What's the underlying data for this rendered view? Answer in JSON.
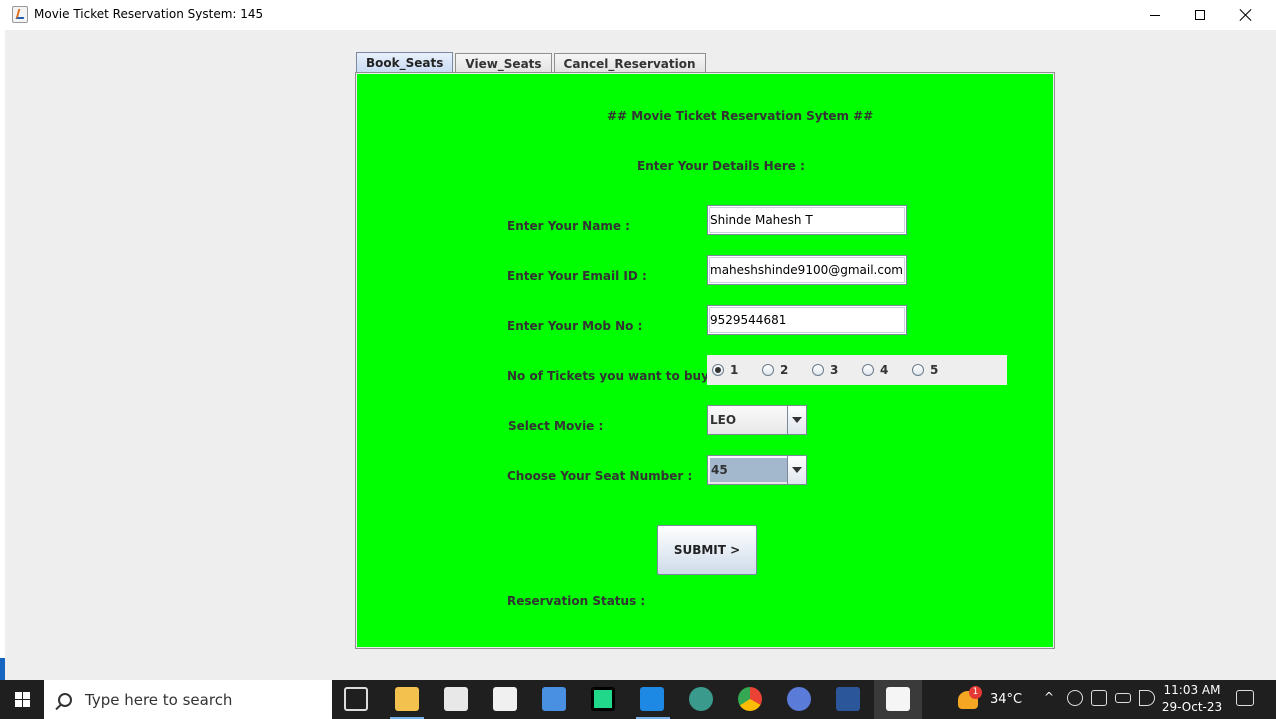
{
  "window": {
    "title": "Movie Ticket Reservation System: 145"
  },
  "tabs": [
    {
      "label": "Book_Seats",
      "active": true
    },
    {
      "label": "View_Seats",
      "active": false
    },
    {
      "label": "Cancel_Reservation",
      "active": false
    }
  ],
  "form": {
    "heading": "## Movie Ticket Reservation Sytem ##",
    "subheading": "Enter Your Details Here :",
    "name_label": "Enter Your Name :",
    "name_value": "Shinde Mahesh T",
    "email_label": "Enter Your Email ID :",
    "email_value": "maheshshinde9100@gmail.com",
    "mobile_label": "Enter Your Mob No :",
    "mobile_value": "9529544681",
    "tickets_label": "No of Tickets you want to buy :",
    "ticket_options": [
      "1",
      "2",
      "3",
      "4",
      "5"
    ],
    "tickets_selected": "1",
    "movie_label": "Select Movie :",
    "movie_value": "LEO",
    "seat_label": "Choose Your Seat Number :",
    "seat_value": "45",
    "submit_label": "SUBMIT >",
    "status_label": "Reservation Status :"
  },
  "colors": {
    "panel_bg": "#00ff00",
    "window_bg": "#eeeeee"
  },
  "taskbar": {
    "search_placeholder": "Type here to search",
    "weather_temp": "34°C",
    "weather_badge": "1",
    "time": "11:03 AM",
    "date": "29-Oct-23",
    "icons": [
      "task-view-icon",
      "file-explorer-icon",
      "store-icon",
      "mail-icon",
      "media-icon",
      "pycharm-icon",
      "vscode-icon",
      "browser-icon",
      "chrome-icon",
      "app-icon",
      "word-icon",
      "java-icon"
    ]
  }
}
